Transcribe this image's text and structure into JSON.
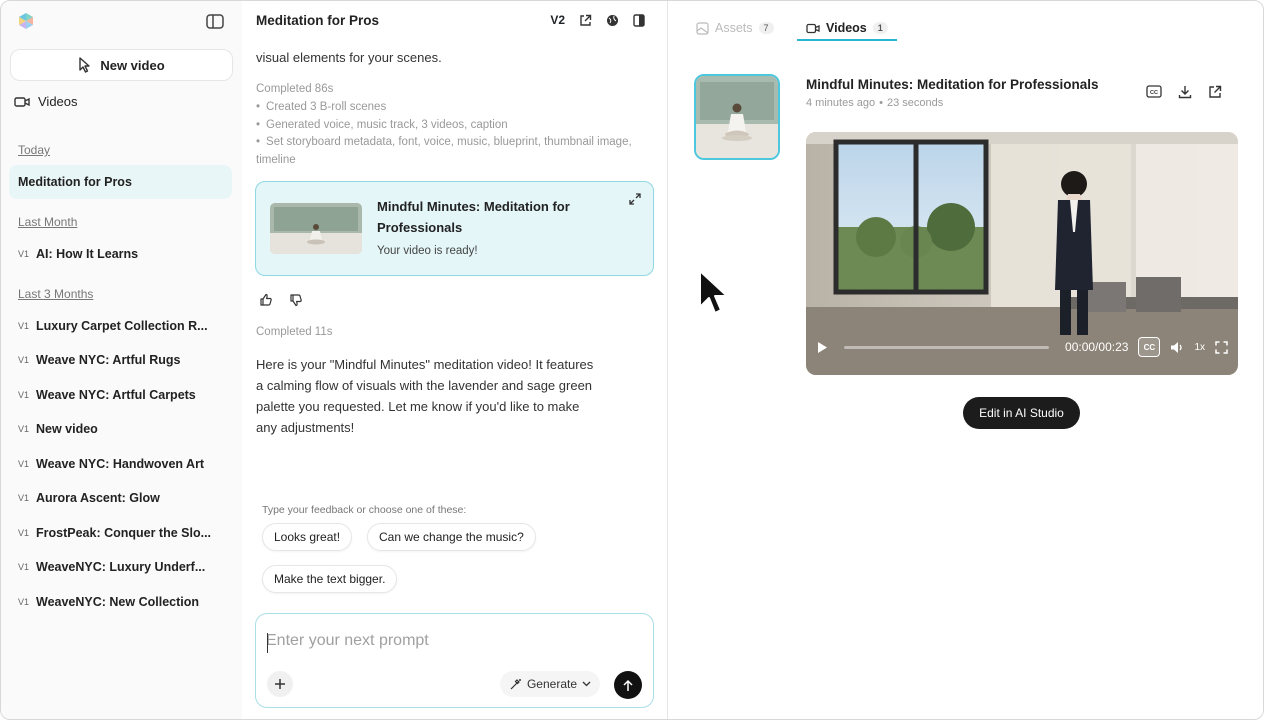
{
  "sidebar": {
    "new_video_label": "New video",
    "videos_label": "Videos",
    "sections": {
      "today": "Today",
      "last_month": "Last Month",
      "last_3_months": "Last 3 Months"
    },
    "version_tag": "V1",
    "items_today": [
      "Meditation for Pros"
    ],
    "items_last_month": [
      "AI: How It Learns"
    ],
    "items_last_3_months": [
      "Luxury Carpet Collection R...",
      "Weave NYC: Artful Rugs",
      "Weave NYC: Artful Carpets",
      "New video",
      "Weave NYC: Handwoven Art",
      "Aurora Ascent: Glow",
      "FrostPeak: Conquer the Slo...",
      "WeaveNYC: Luxury Underf...",
      "WeaveNYC: New Collection"
    ]
  },
  "chat": {
    "title": "Meditation for Pros",
    "version": "V2",
    "intro_text": "visual elements for your scenes.",
    "completed_1": "Completed 86s",
    "bullets": [
      "Created 3 B-roll scenes",
      "Generated voice, music track, 3 videos, caption",
      "Set storyboard metadata, font, voice, music, blueprint, thumbnail image, timeline"
    ],
    "card": {
      "title": "Mindful Minutes: Meditation for Professionals",
      "subtitle": "Your video is ready!"
    },
    "completed_2": "Completed 11s",
    "response": "Here is your \"Mindful Minutes\" meditation video! It features a calming flow of visuals with the lavender and sage green palette you requested. Let me know if you'd like to make any adjustments!",
    "feedback_label": "Type your feedback or choose one of these:",
    "chips": [
      "Looks great!",
      "Can we change the music?",
      "Make the text bigger."
    ],
    "prompt_placeholder": "Enter your next prompt",
    "generate_label": "Generate"
  },
  "right": {
    "tabs": [
      {
        "label": "Assets",
        "count": "7"
      },
      {
        "label": "Videos",
        "count": "1"
      }
    ],
    "active_tab": "Videos",
    "video": {
      "title": "Mindful Minutes: Meditation for Professionals",
      "age": "4 minutes ago",
      "duration": "23 seconds",
      "time": "00:00/00:23",
      "speed": "1x",
      "progress": 0
    },
    "edit_label": "Edit in AI Studio"
  },
  "colors": {
    "accent": "#27b6d0",
    "card_bg": "#e4f6f8",
    "card_border": "#8fd8e4",
    "dark_button": "#1c1c1c"
  }
}
